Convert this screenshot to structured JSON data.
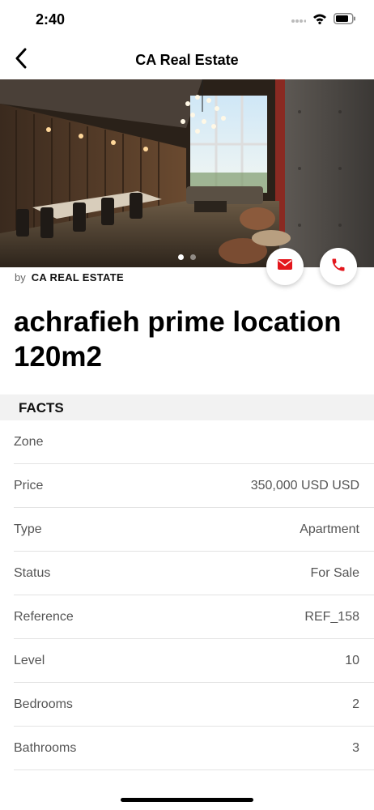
{
  "status_bar": {
    "time": "2:40",
    "icons": [
      "signal-icon",
      "wifi-icon",
      "battery-icon"
    ]
  },
  "nav": {
    "title": "CA Real Estate",
    "back_icon": "chevron-left-icon"
  },
  "gallery": {
    "image_description_icon": "property-photo",
    "page_count": 2,
    "current_page": 1
  },
  "actions": {
    "email_icon": "envelope-icon",
    "call_icon": "phone-icon",
    "accent_color": "#e3161c"
  },
  "listing": {
    "by_prefix": "by",
    "agency": "CA REAL ESTATE",
    "title": "achrafieh prime location 120m2"
  },
  "facts": {
    "header": "FACTS",
    "rows": [
      {
        "label": "Zone",
        "value": ""
      },
      {
        "label": "Price",
        "value": "350,000 USD USD"
      },
      {
        "label": "Type",
        "value": "Apartment"
      },
      {
        "label": "Status",
        "value": "For Sale"
      },
      {
        "label": "Reference",
        "value": "REF_158"
      },
      {
        "label": "Level",
        "value": "10"
      },
      {
        "label": "Bedrooms",
        "value": "2"
      },
      {
        "label": "Bathrooms",
        "value": "3"
      }
    ]
  }
}
